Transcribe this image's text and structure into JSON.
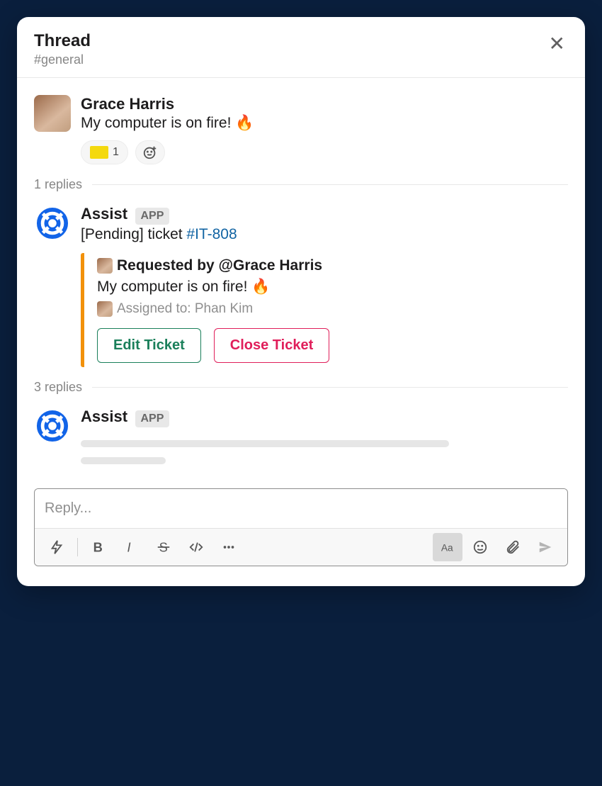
{
  "header": {
    "title": "Thread",
    "channel": "#general"
  },
  "message1": {
    "author": "Grace Harris",
    "text": "My computer is on fire! 🔥",
    "reaction_count": "1"
  },
  "replies1_label": "1 replies",
  "message2": {
    "author": "Assist",
    "app_badge": "APP",
    "text_prefix": "[Pending] ticket ",
    "ticket_id": "#IT-808",
    "attachment": {
      "requested_by": "Requested by @Grace Harris",
      "body": "My computer is on fire! 🔥",
      "assigned_to": "Assigned to: Phan Kim",
      "edit_label": "Edit Ticket",
      "close_label": "Close Ticket"
    }
  },
  "replies2_label": "3 replies",
  "message3": {
    "author": "Assist",
    "app_badge": "APP"
  },
  "composer": {
    "placeholder": "Reply..."
  }
}
